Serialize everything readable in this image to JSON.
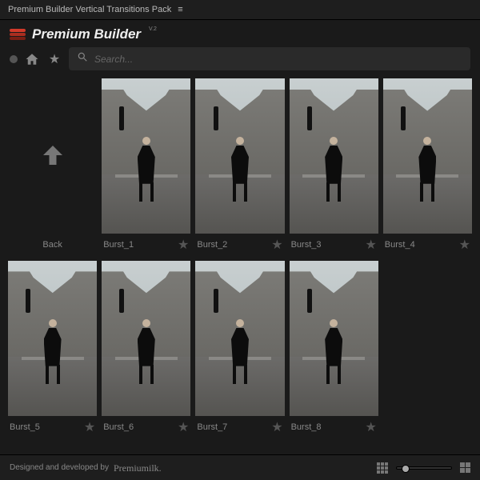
{
  "titlebar": {
    "title": "Premium Builder Vertical Transitions Pack"
  },
  "brand": {
    "name": "Premium Builder",
    "version": "V.2"
  },
  "search": {
    "placeholder": "Search..."
  },
  "nav": {
    "back_label": "Back"
  },
  "items": [
    {
      "label": "Burst_1"
    },
    {
      "label": "Burst_2"
    },
    {
      "label": "Burst_3"
    },
    {
      "label": "Burst_4"
    },
    {
      "label": "Burst_5"
    },
    {
      "label": "Burst_6"
    },
    {
      "label": "Burst_7"
    },
    {
      "label": "Burst_8"
    }
  ],
  "footer": {
    "text": "Designed and developed by",
    "credit": "Premiumilk."
  }
}
